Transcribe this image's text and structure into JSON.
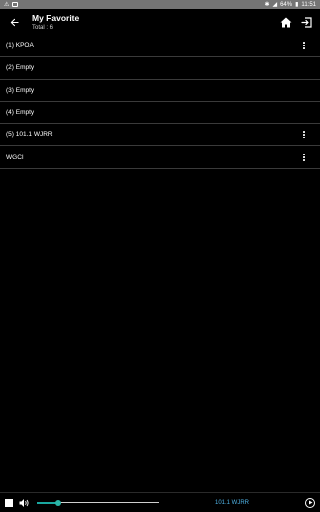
{
  "status_bar": {
    "battery": "64%",
    "time": "11:51",
    "left_icons": [
      "alert-icon",
      "image-icon"
    ],
    "right_icons": [
      "bluetooth-icon",
      "signal-icon",
      "battery-icon"
    ]
  },
  "header": {
    "title": "My Favorite",
    "subtitle": "Total : 6",
    "icons": [
      "back-arrow-icon",
      "home-icon",
      "exit-icon"
    ]
  },
  "favorites": [
    {
      "label": "(1) KPOA",
      "has_menu": true
    },
    {
      "label": "(2) Empty",
      "has_menu": false
    },
    {
      "label": "(3) Empty",
      "has_menu": false
    },
    {
      "label": "(4) Empty",
      "has_menu": false
    },
    {
      "label": "(5) 101.1 WJRR",
      "has_menu": true
    },
    {
      "label": "WGCI",
      "has_menu": true
    }
  ],
  "player": {
    "now_playing": "101.1 WJRR",
    "volume_level": 0.17,
    "accent_color": "#2bb5a8",
    "station_color": "#4fb3e6"
  }
}
